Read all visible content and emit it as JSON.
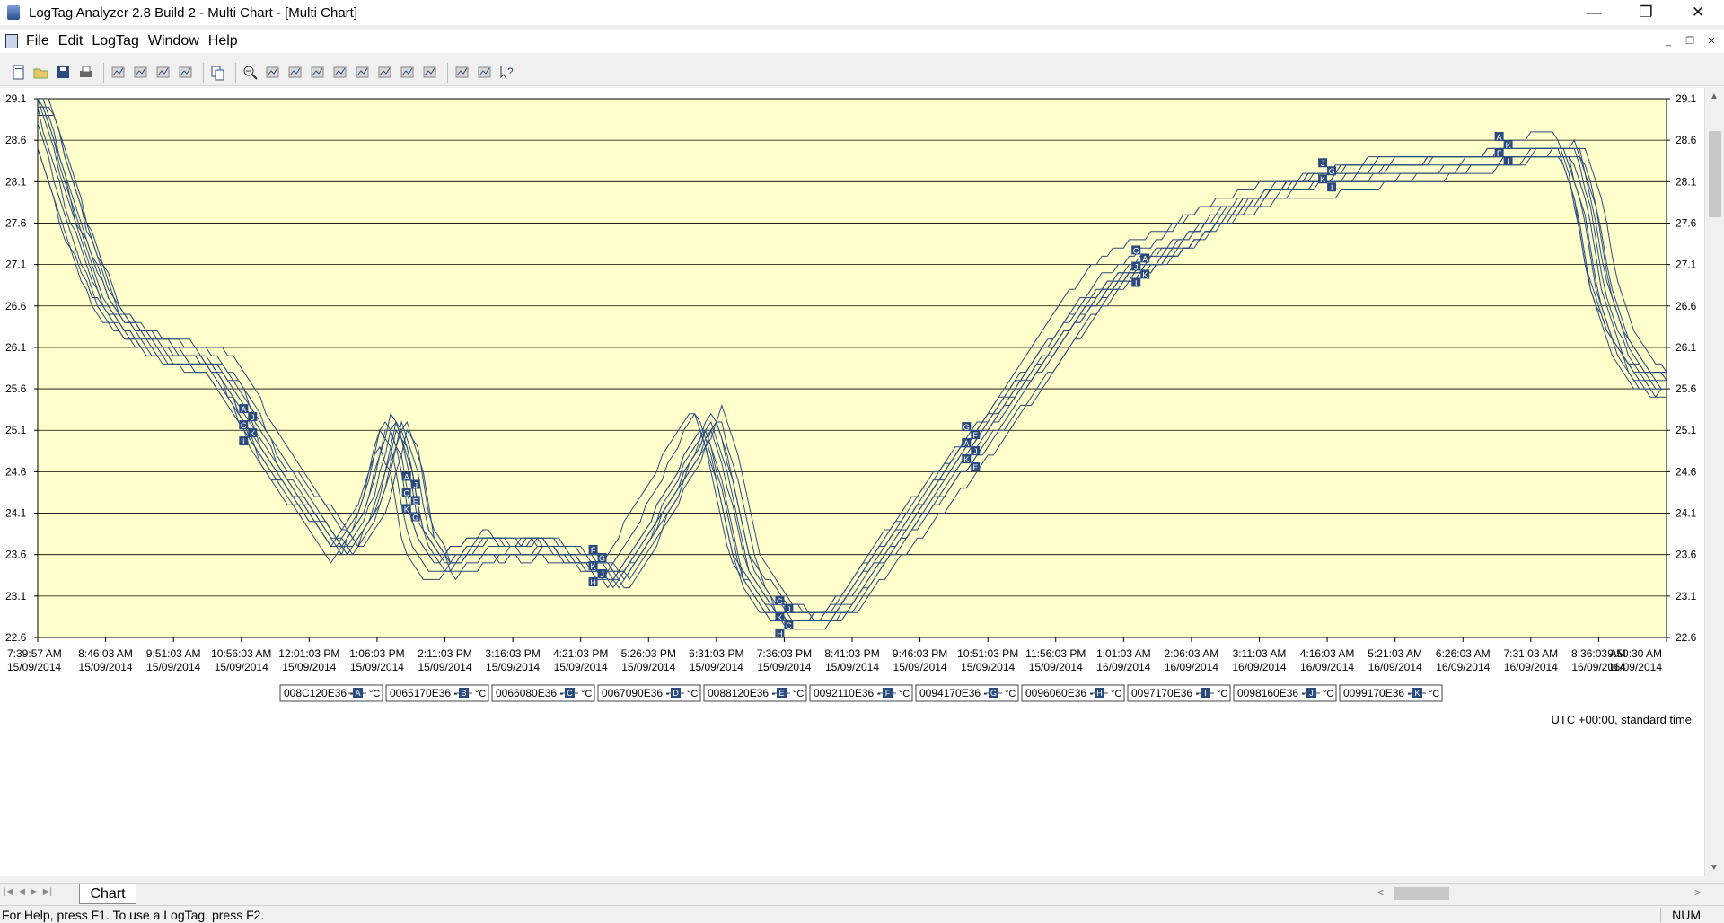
{
  "window": {
    "title": "LogTag Analyzer 2.8 Build 2 - Multi Chart - [Multi Chart]",
    "min": "—",
    "restore": "❐",
    "close": "✕"
  },
  "menu": {
    "items": [
      "File",
      "Edit",
      "LogTag",
      "Window",
      "Help"
    ]
  },
  "mdi": {
    "min": "_",
    "restore": "❐",
    "close": "✕"
  },
  "toolbar": {
    "groups": [
      [
        "new-icon",
        "open-icon",
        "save-icon",
        "print-icon"
      ],
      [
        "download-icon",
        "configure-icon",
        "filter-icon",
        "logger-icon"
      ],
      [
        "copy-icon"
      ],
      [
        "zoom-out-icon",
        "zoom-table-icon",
        "mark-icon",
        "axis-icon",
        "axis-down-icon",
        "axis-up-icon",
        "chart-icon",
        "wave-icon",
        "line-chart-icon"
      ],
      [
        "tools-icon",
        "hand-icon",
        "context-help-icon"
      ]
    ],
    "accent": "#2b4b7f"
  },
  "chart_data": {
    "type": "line",
    "title": "Multi Chart",
    "xlabel": "",
    "ylabel": "",
    "ylim": [
      22.6,
      29.1
    ],
    "y_ticks": [
      "29.1",
      "28.6",
      "28.1",
      "27.6",
      "27.1",
      "26.6",
      "26.1",
      "25.6",
      "25.1",
      "24.6",
      "24.1",
      "23.6",
      "23.1",
      "22.6"
    ],
    "x_tick_labels": [
      [
        "7:39:57 AM",
        "15/09/2014"
      ],
      [
        "8:46:03 AM",
        "15/09/2014"
      ],
      [
        "9:51:03 AM",
        "15/09/2014"
      ],
      [
        "10:56:03 AM",
        "15/09/2014"
      ],
      [
        "12:01:03 PM",
        "15/09/2014"
      ],
      [
        "1:06:03 PM",
        "15/09/2014"
      ],
      [
        "2:11:03 PM",
        "15/09/2014"
      ],
      [
        "3:16:03 PM",
        "15/09/2014"
      ],
      [
        "4:21:03 PM",
        "15/09/2014"
      ],
      [
        "5:26:03 PM",
        "15/09/2014"
      ],
      [
        "6:31:03 PM",
        "15/09/2014"
      ],
      [
        "7:36:03 PM",
        "15/09/2014"
      ],
      [
        "8:41:03 PM",
        "15/09/2014"
      ],
      [
        "9:46:03 PM",
        "15/09/2014"
      ],
      [
        "10:51:03 PM",
        "15/09/2014"
      ],
      [
        "11:56:03 PM",
        "15/09/2014"
      ],
      [
        "1:01:03 AM",
        "16/09/2014"
      ],
      [
        "2:06:03 AM",
        "16/09/2014"
      ],
      [
        "3:11:03 AM",
        "16/09/2014"
      ],
      [
        "4:16:03 AM",
        "16/09/2014"
      ],
      [
        "5:21:03 AM",
        "16/09/2014"
      ],
      [
        "6:26:03 AM",
        "16/09/2014"
      ],
      [
        "7:31:03 AM",
        "16/09/2014"
      ],
      [
        "8:36:03 AM",
        "16/09/2014"
      ],
      [
        "9:50:30 AM",
        "16/09/2014"
      ]
    ],
    "grid": true,
    "plot_background": "#ffffcc",
    "line_color": "#2b4b7f",
    "timezone_note": "UTC +00:00, standard time",
    "base_curve": [
      [
        0,
        29.1
      ],
      [
        0.5,
        27.7
      ],
      [
        1,
        26.6
      ],
      [
        1.5,
        26.2
      ],
      [
        2,
        26.0
      ],
      [
        2.5,
        25.9
      ],
      [
        2.9,
        25.5
      ],
      [
        3.2,
        25.0
      ],
      [
        3.5,
        24.6
      ],
      [
        3.9,
        24.2
      ],
      [
        4.3,
        23.8
      ],
      [
        4.5,
        23.6
      ],
      [
        4.9,
        24.2
      ],
      [
        5.2,
        25.2
      ],
      [
        5.4,
        24.8
      ],
      [
        5.6,
        23.9
      ],
      [
        5.9,
        23.5
      ],
      [
        6.2,
        23.6
      ],
      [
        6.6,
        23.8
      ],
      [
        7.0,
        23.7
      ],
      [
        7.4,
        23.8
      ],
      [
        7.8,
        23.6
      ],
      [
        8.2,
        23.5
      ],
      [
        8.5,
        23.3
      ],
      [
        9.0,
        23.9
      ],
      [
        9.6,
        24.8
      ],
      [
        9.85,
        25.2
      ],
      [
        10.1,
        24.5
      ],
      [
        10.4,
        23.4
      ],
      [
        10.8,
        22.9
      ],
      [
        11.2,
        22.8
      ],
      [
        11.5,
        22.8
      ],
      [
        11.8,
        22.9
      ],
      [
        12.3,
        23.5
      ],
      [
        12.8,
        24.0
      ],
      [
        13.3,
        24.5
      ],
      [
        13.8,
        25.0
      ],
      [
        14.3,
        25.5
      ],
      [
        14.8,
        26.0
      ],
      [
        15.3,
        26.5
      ],
      [
        15.8,
        26.9
      ],
      [
        16.3,
        27.1
      ],
      [
        16.8,
        27.3
      ],
      [
        17.3,
        27.6
      ],
      [
        17.8,
        27.8
      ],
      [
        18.3,
        28.0
      ],
      [
        18.8,
        28.1
      ],
      [
        19.4,
        28.2
      ],
      [
        20.0,
        28.3
      ],
      [
        20.5,
        28.35
      ],
      [
        21.0,
        28.4
      ],
      [
        21.6,
        28.45
      ],
      [
        22.1,
        28.5
      ],
      [
        22.55,
        28.5
      ],
      [
        22.8,
        27.8
      ],
      [
        23.0,
        26.8
      ],
      [
        23.3,
        26.1
      ],
      [
        23.6,
        25.7
      ],
      [
        23.9,
        25.6
      ],
      [
        24,
        25.6
      ]
    ],
    "series": [
      {
        "name": "008C120E36 -",
        "letter": "A",
        "offset": -0.08,
        "shift": 0.05
      },
      {
        "name": "0065170E36 -",
        "letter": "B",
        "offset": 0.0,
        "shift": -0.05
      },
      {
        "name": "0066080E36 -",
        "letter": "C",
        "offset": -0.15,
        "shift": 0.1
      },
      {
        "name": "0067090E36 -",
        "letter": "D",
        "offset": 0.08,
        "shift": -0.1
      },
      {
        "name": "0088120E36 -",
        "letter": "E",
        "offset": -0.04,
        "shift": 0.15
      },
      {
        "name": "0092110E36 -",
        "letter": "F",
        "offset": 0.18,
        "shift": -0.15
      },
      {
        "name": "0094170E36 -",
        "letter": "G",
        "offset": 0.26,
        "shift": -0.2
      },
      {
        "name": "0096060E36 -",
        "letter": "H",
        "offset": -0.12,
        "shift": 0.2
      },
      {
        "name": "0097170E36 -",
        "letter": "I",
        "offset": -0.2,
        "shift": 0.25
      },
      {
        "name": "0098160E36 -",
        "letter": "J",
        "offset": 0.12,
        "shift": 0.0
      },
      {
        "name": "0099170E36 -",
        "letter": "K",
        "offset": -0.02,
        "shift": 0.08
      }
    ],
    "legend_unit": "°C",
    "legend_placement": "bottom",
    "marker_clusters": [
      {
        "x": 3.1,
        "letters": [
          "A",
          "J",
          "G",
          "K",
          "I"
        ]
      },
      {
        "x": 5.5,
        "letters": [
          "A",
          "J",
          "C",
          "E",
          "K",
          "G"
        ]
      },
      {
        "x": 8.25,
        "letters": [
          "F",
          "G",
          "K",
          "J",
          "H"
        ]
      },
      {
        "x": 11.0,
        "letters": [
          "G",
          "J",
          "K",
          "C",
          "H"
        ]
      },
      {
        "x": 13.75,
        "letters": [
          "G",
          "F",
          "A",
          "J",
          "K",
          "E"
        ]
      },
      {
        "x": 16.25,
        "letters": [
          "G",
          "A",
          "J",
          "K",
          "I"
        ]
      },
      {
        "x": 19.0,
        "letters": [
          "J",
          "G",
          "K",
          "I"
        ]
      },
      {
        "x": 21.6,
        "letters": [
          "A",
          "K",
          "F",
          "I"
        ]
      }
    ]
  },
  "tabs": {
    "active": "Chart"
  },
  "status": {
    "text": "For Help, press F1. To use a LogTag, press F2.",
    "num": "NUM"
  }
}
